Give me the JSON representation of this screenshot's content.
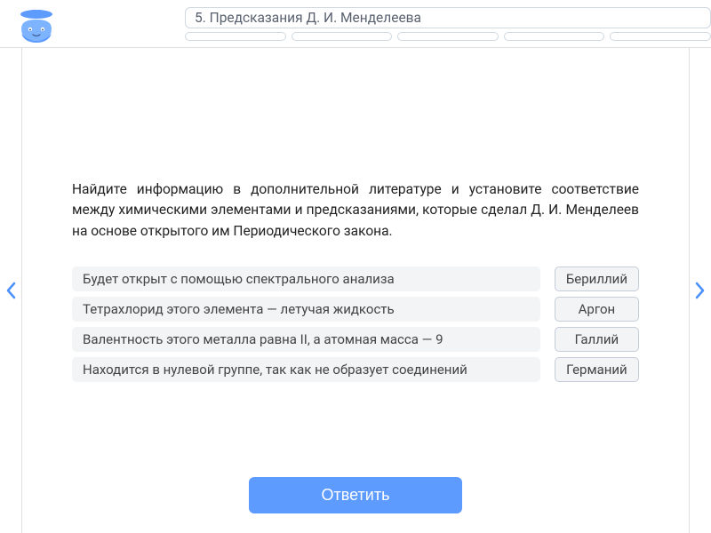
{
  "header": {
    "title": "5. Предсказания Д. И. Менделеева"
  },
  "question": "Найдите информацию в дополнительной литературе и установите соответствие между химическими элементами и предсказаниями, которые сделал Д. И. Менделеев на основе открытого им Периодического закона.",
  "prompts": [
    "Будет открыт с помощью спектрального анализа",
    "Тетрахлорид этого элемента — летучая жидкость",
    "Валентность этого металла равна II, а атомная масса — 9",
    "Находится в нулевой группе, так как не образует соединений"
  ],
  "options": [
    "Бериллий",
    "Аргон",
    "Галлий",
    "Германий"
  ],
  "buttons": {
    "answer": "Ответить"
  }
}
